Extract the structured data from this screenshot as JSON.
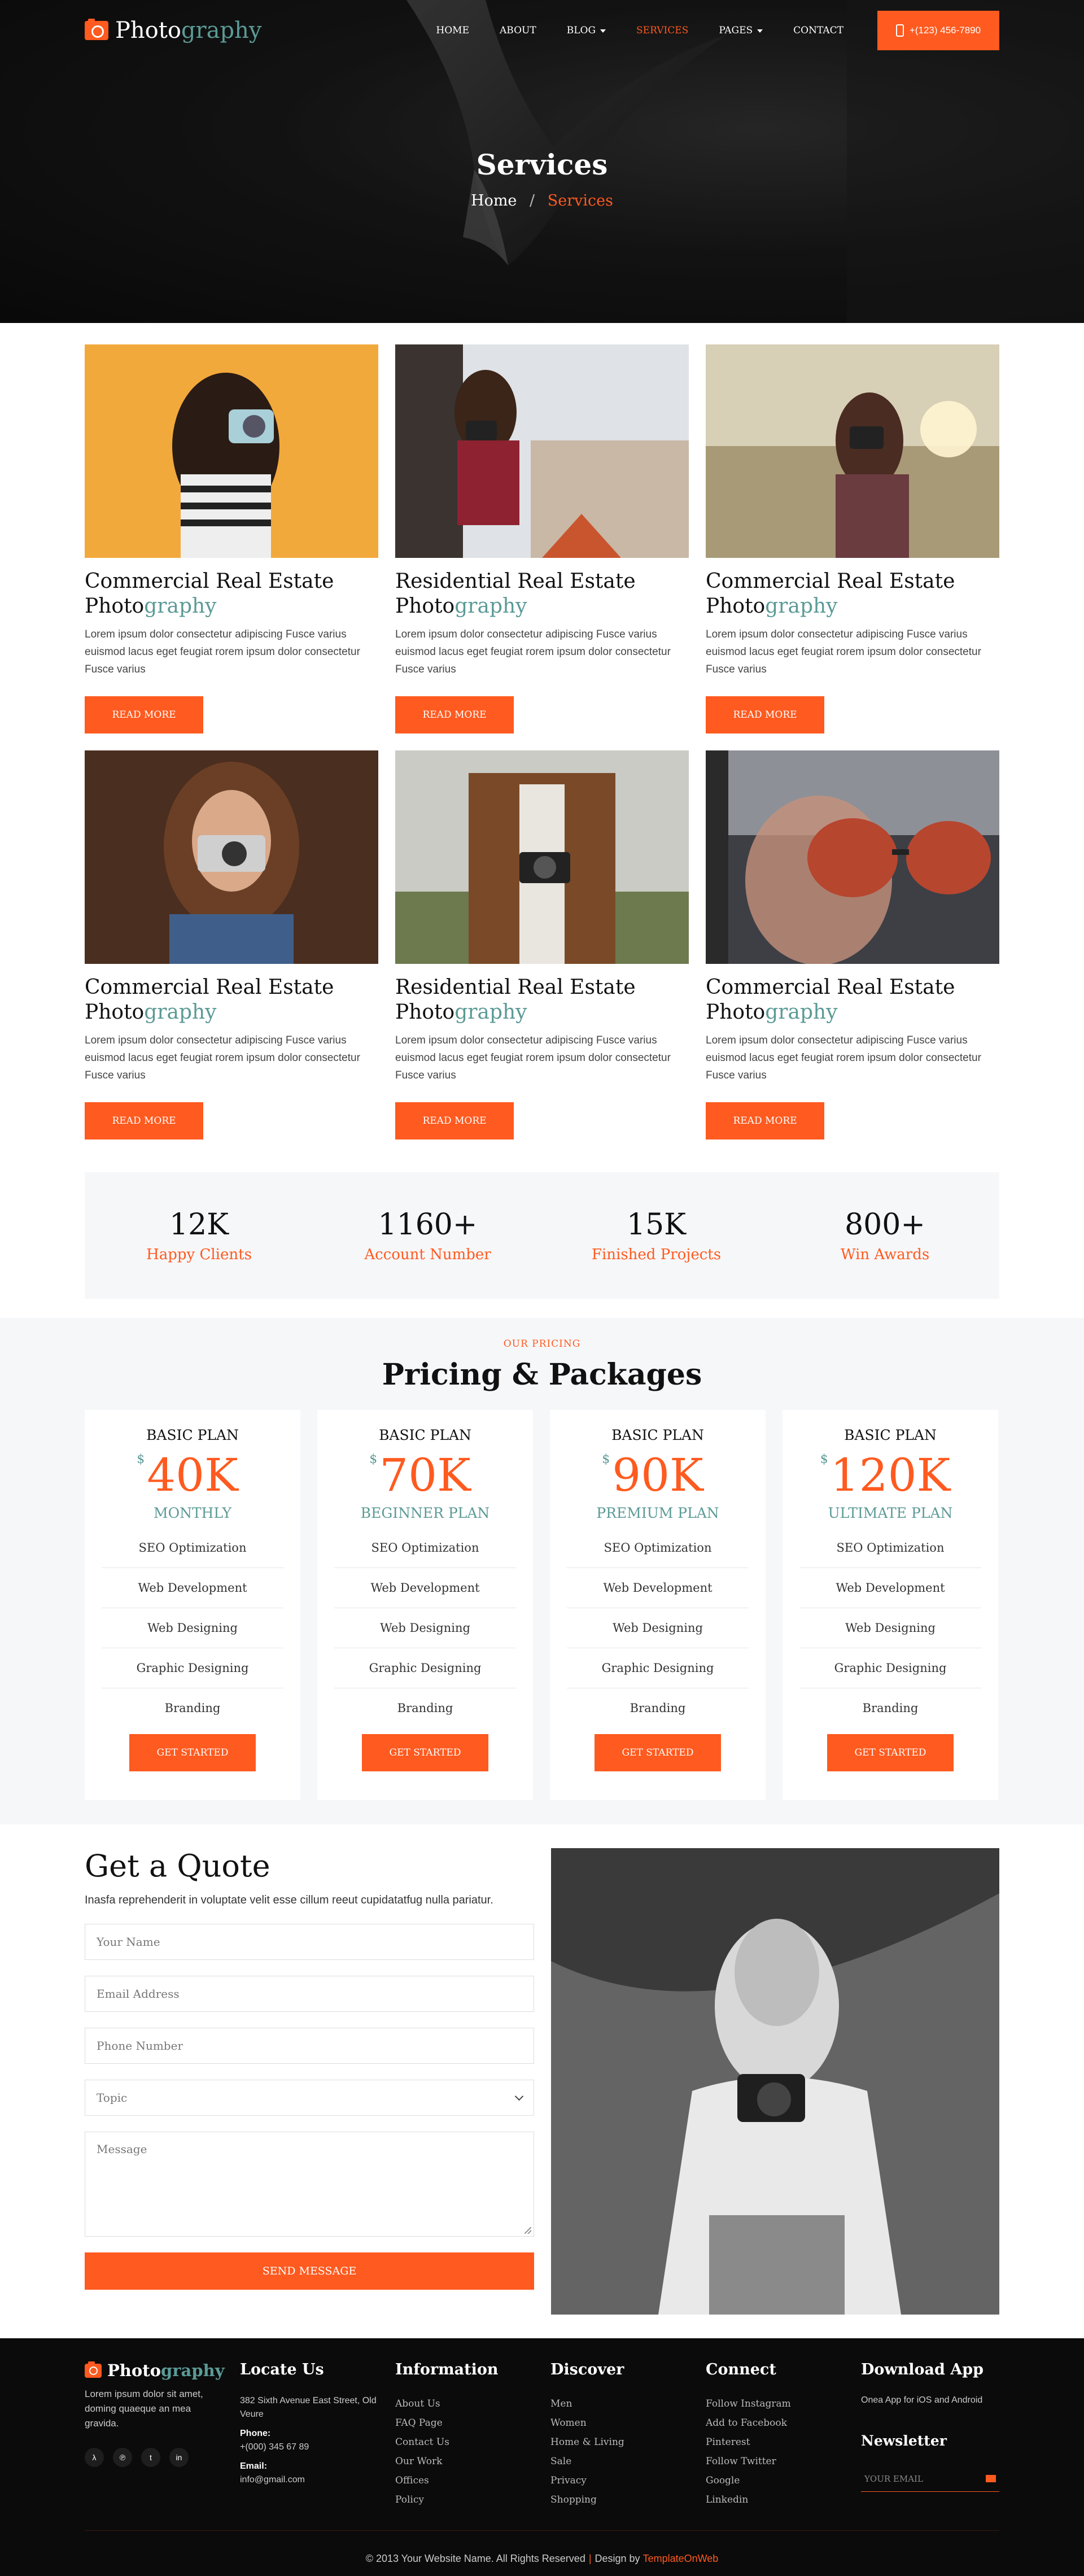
{
  "brand": {
    "part1": "Photo",
    "part2": "graphy",
    "accent": "#ff5a1f",
    "teal": "#5b9a96"
  },
  "nav": {
    "items": [
      {
        "label": "HOME",
        "active": false,
        "dropdown": false
      },
      {
        "label": "ABOUT",
        "active": false,
        "dropdown": false
      },
      {
        "label": "BLOG",
        "active": false,
        "dropdown": true
      },
      {
        "label": "SERVICES",
        "active": true,
        "dropdown": false
      },
      {
        "label": "PAGES",
        "active": false,
        "dropdown": true
      },
      {
        "label": "CONTACT",
        "active": false,
        "dropdown": false
      }
    ],
    "phone": "+(123) 456-7890",
    "phone_icon": "mobile-phone-icon"
  },
  "hero": {
    "title": "Services",
    "crumb_home": "Home",
    "crumb_sep": "/",
    "crumb_current": "Services"
  },
  "services": [
    {
      "title1": "Commercial Real Estate",
      "title2a": "Photo",
      "title2b": "graphy",
      "text": "Lorem ipsum dolor consectetur adipiscing Fusce varius euismod lacus eget feugiat rorem ipsum dolor consectetur Fusce varius",
      "button": "READ MORE"
    },
    {
      "title1": "Residential Real Estate",
      "title2a": "Photo",
      "title2b": "graphy",
      "text": "Lorem ipsum dolor consectetur adipiscing Fusce varius euismod lacus eget feugiat rorem ipsum dolor consectetur Fusce varius",
      "button": "READ MORE"
    },
    {
      "title1": "Commercial Real Estate",
      "title2a": "Photo",
      "title2b": "graphy",
      "text": "Lorem ipsum dolor consectetur adipiscing Fusce varius euismod lacus eget feugiat rorem ipsum dolor consectetur Fusce varius",
      "button": "READ MORE"
    },
    {
      "title1": "Commercial Real Estate",
      "title2a": "Photo",
      "title2b": "graphy",
      "text": "Lorem ipsum dolor consectetur adipiscing Fusce varius euismod lacus eget feugiat rorem ipsum dolor consectetur Fusce varius",
      "button": "READ MORE"
    },
    {
      "title1": "Residential Real Estate",
      "title2a": "Photo",
      "title2b": "graphy",
      "text": "Lorem ipsum dolor consectetur adipiscing Fusce varius euismod lacus eget feugiat rorem ipsum dolor consectetur Fusce varius",
      "button": "READ MORE"
    },
    {
      "title1": "Commercial Real Estate",
      "title2a": "Photo",
      "title2b": "graphy",
      "text": "Lorem ipsum dolor consectetur adipiscing Fusce varius euismod lacus eget feugiat rorem ipsum dolor consectetur Fusce varius",
      "button": "READ MORE"
    }
  ],
  "stats": [
    {
      "num": "12K",
      "label": "Happy Clients"
    },
    {
      "num": "1160+",
      "label": "Account Number"
    },
    {
      "num": "15K",
      "label": "Finished Projects"
    },
    {
      "num": "800+",
      "label": "Win Awards"
    }
  ],
  "pricing": {
    "eyebrow": "OUR PRICING",
    "title": "Pricing & Packages",
    "currency": "$",
    "plans": [
      {
        "name": "BASIC PLAN",
        "price": "40K",
        "tier": "MONTHLY",
        "features": [
          "SEO Optimization",
          "Web Development",
          "Web Designing",
          "Graphic Designing",
          "Branding"
        ],
        "button": "GET STARTED"
      },
      {
        "name": "BASIC PLAN",
        "price": "70K",
        "tier": "BEGINNER PLAN",
        "features": [
          "SEO Optimization",
          "Web Development",
          "Web Designing",
          "Graphic Designing",
          "Branding"
        ],
        "button": "GET STARTED"
      },
      {
        "name": "BASIC PLAN",
        "price": "90K",
        "tier": "PREMIUM PLAN",
        "features": [
          "SEO Optimization",
          "Web Development",
          "Web Designing",
          "Graphic Designing",
          "Branding"
        ],
        "button": "GET STARTED"
      },
      {
        "name": "BASIC PLAN",
        "price": "120K",
        "tier": "ULTIMATE PLAN",
        "features": [
          "SEO Optimization",
          "Web Development",
          "Web Designing",
          "Graphic Designing",
          "Branding"
        ],
        "button": "GET STARTED"
      }
    ]
  },
  "quote": {
    "title": "Get a Quote",
    "intro": "Inasfa reprehenderit in voluptate velit esse cillum reeut cupidatatfug nulla pariatur.",
    "name_placeholder": "Your Name",
    "email_placeholder": "Email Address",
    "phone_placeholder": "Phone Number",
    "topic_value": "Topic",
    "message_placeholder": "Message",
    "button": "SEND MESSAGE"
  },
  "footer": {
    "about": "Lorem ipsum dolor sit amet, doming quaeque an mea gravida.",
    "social": [
      {
        "icon": "rss-icon",
        "glyph": "λ"
      },
      {
        "icon": "pinterest-icon",
        "glyph": "℗"
      },
      {
        "icon": "twitter-icon",
        "glyph": "t"
      },
      {
        "icon": "linkedin-icon",
        "glyph": "in"
      }
    ],
    "locate": {
      "heading": "Locate Us",
      "address": "382 Sixth Avenue East Street, Old Veure",
      "phone_label": "Phone:",
      "phone": "+(000) 345 67 89",
      "email_label": "Email:",
      "email": "info@gmail.com"
    },
    "information": {
      "heading": "Information",
      "links": [
        "About Us",
        "FAQ Page",
        "Contact Us",
        "Our Work",
        "Offices",
        "Policy"
      ]
    },
    "discover": {
      "heading": "Discover",
      "links": [
        "Men",
        "Women",
        "Home & Living",
        "Sale",
        "Privacy",
        "Shopping"
      ]
    },
    "connect": {
      "heading": "Connect",
      "links": [
        "Follow Instagram",
        "Add to Facebook",
        "Pinterest",
        "Follow Twitter",
        "Google",
        "Linkedin"
      ]
    },
    "app": {
      "heading": "Download App",
      "text": "Onea App for iOS and Android",
      "newsletter": "Newsletter",
      "email_placeholder": "YOUR EMAIL"
    },
    "copyright": "© 2013 Your Website Name. All Rights Reserved",
    "design_by": "Design by",
    "designer": "TemplateOnWeb"
  }
}
